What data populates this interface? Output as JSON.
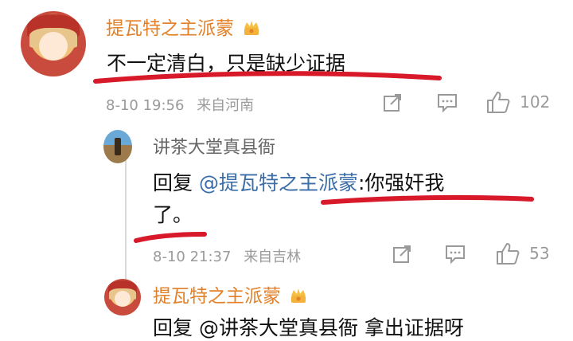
{
  "comment1": {
    "username": "提瓦特之主派蒙",
    "text": "不一定清白，只是缺少证据",
    "time": "8-10 19:56",
    "location": "来自河南",
    "likes": "102"
  },
  "reply1": {
    "username": "讲茶大堂真县衙",
    "prefix": "回复",
    "mention": "@提瓦特之主派蒙",
    "text_line1": ":你强奸我",
    "text_line2": "了。",
    "time": "8-10 21:37",
    "location": "来自吉林",
    "likes": "53"
  },
  "reply2": {
    "username": "提瓦特之主派蒙",
    "partial_text": "回复 @讲茶大堂真县衙 拿出证据呀"
  },
  "icons": {
    "share": "share-icon",
    "comment": "comment-icon",
    "like": "thumbs-up-icon",
    "badge": "crown-badge-icon"
  },
  "colors": {
    "username": "#e2812a",
    "mention": "#3b6ea8",
    "annotation": "#d8192a"
  }
}
